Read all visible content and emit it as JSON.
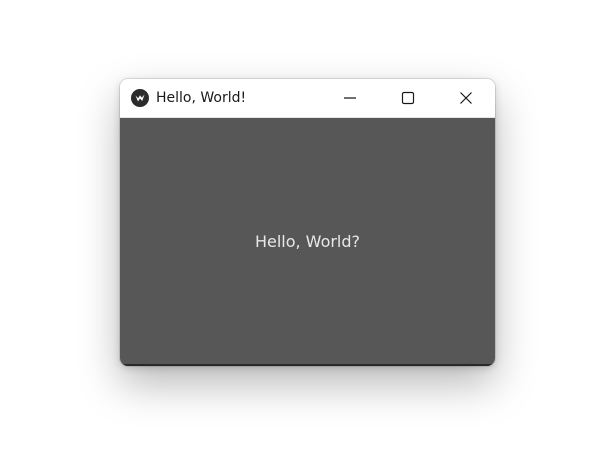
{
  "window": {
    "title": "Hello, World!",
    "icon": "kivy-logo-icon",
    "controls": [
      "minimize-icon",
      "maximize-icon",
      "close-icon"
    ]
  },
  "content": {
    "label": "Hello, World?",
    "background": "#575757",
    "text_color": "#e8e8e8"
  }
}
